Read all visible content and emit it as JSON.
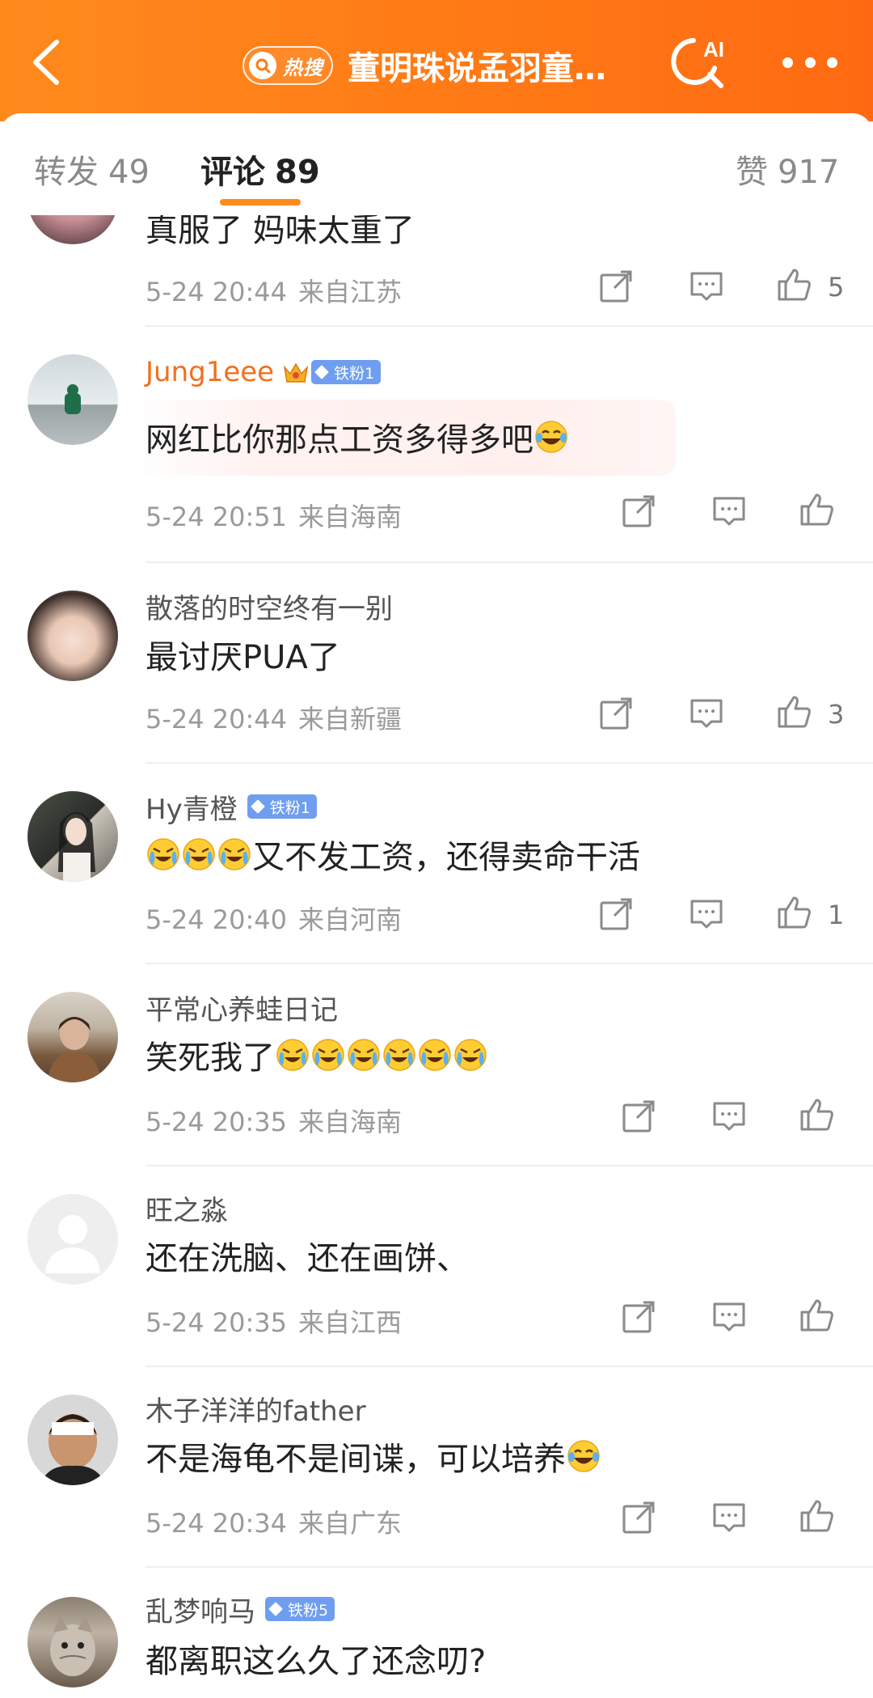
{
  "header": {
    "hot_label": "热搜",
    "title": "董明珠说孟羽童…",
    "ai_label": "AI",
    "colors": {
      "primary": "#ff7a16",
      "accent": "#f0701e"
    }
  },
  "tabs": [
    {
      "label": "转发",
      "count": "49"
    },
    {
      "label": "评论",
      "count": "89"
    },
    {
      "label": "赞",
      "count": "917"
    }
  ],
  "comments": [
    {
      "text": "真服了 妈味太重了",
      "time": "5-24 20:44",
      "location": "来自江苏",
      "likes": "5"
    },
    {
      "user": "Jung1eee",
      "badge": "铁粉1",
      "text": "网红比你那点工资多得多吧",
      "emoji": [
        "laugh-emoji"
      ],
      "time": "5-24 20:51",
      "location": "来自海南",
      "likes": ""
    },
    {
      "user": "散落的时空终有一别",
      "text": "最讨厌PUA了",
      "time": "5-24 20:44",
      "location": "来自新疆",
      "likes": "3"
    },
    {
      "user": "Hy青橙",
      "badge": "铁粉1",
      "text": "又不发工资，还得卖命干活",
      "emoji_prefix": [
        "cry-laugh-emoji",
        "cry-laugh-emoji",
        "cry-laugh-emoji"
      ],
      "time": "5-24 20:40",
      "location": "来自河南",
      "likes": "1"
    },
    {
      "user": "平常心养蛙日记",
      "text": "笑死我了",
      "emoji": [
        "cry-laugh-emoji",
        "cry-laugh-emoji",
        "cry-laugh-emoji",
        "cry-laugh-emoji",
        "cry-laugh-emoji",
        "cry-laugh-emoji"
      ],
      "time": "5-24 20:35",
      "location": "来自海南",
      "likes": ""
    },
    {
      "user": "旺之淼",
      "text": "还在洗脑、还在画饼、",
      "time": "5-24 20:35",
      "location": "来自江西",
      "likes": ""
    },
    {
      "user": "木子洋洋的father",
      "text": "不是海龟不是间谍，可以培养",
      "emoji": [
        "laugh-emoji"
      ],
      "time": "5-24 20:34",
      "location": "来自广东",
      "likes": ""
    },
    {
      "user": "乱梦响马",
      "badge": "铁粉5",
      "text": "都离职这么久了还念叨?"
    }
  ]
}
